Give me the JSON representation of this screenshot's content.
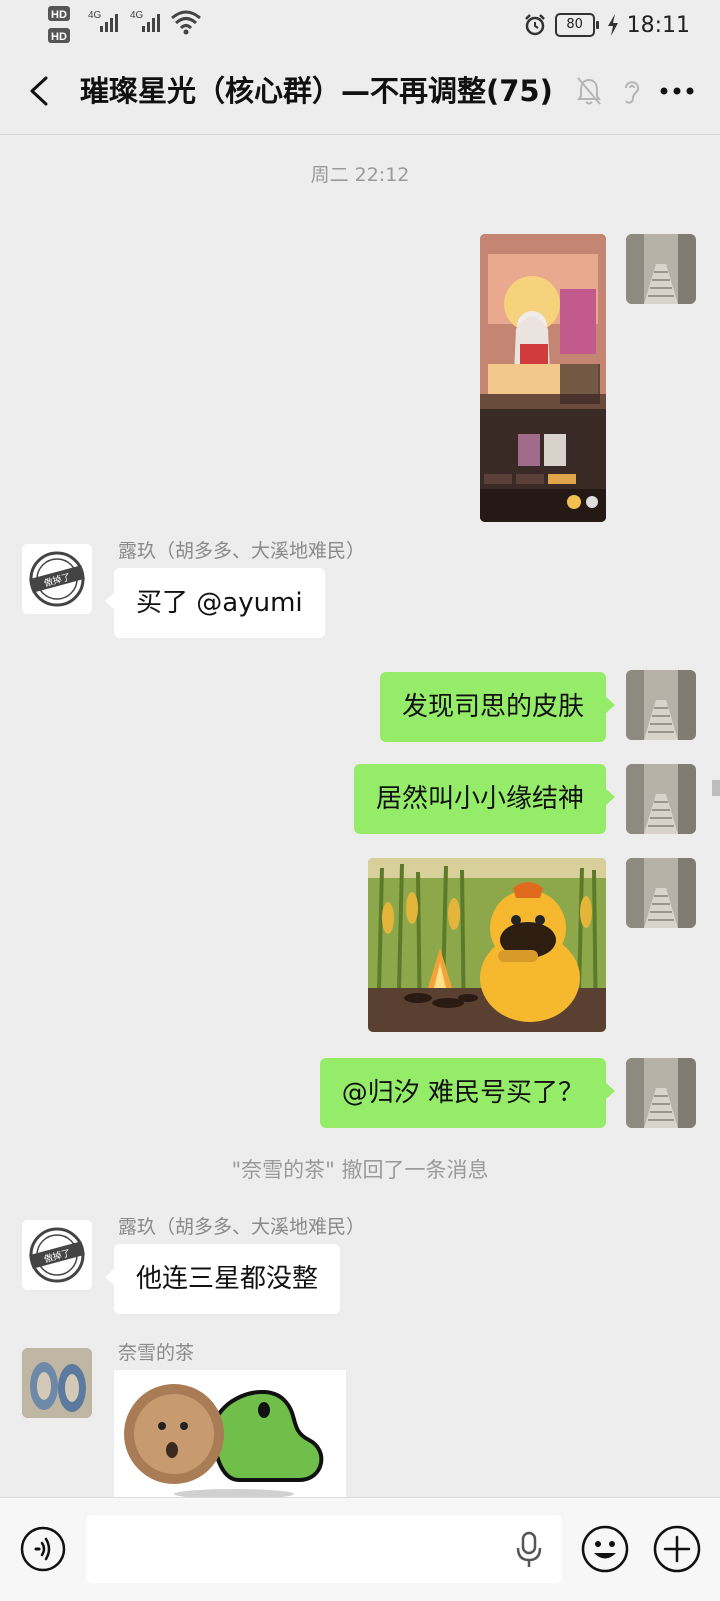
{
  "status_bar": {
    "time": "18:11",
    "battery": "80",
    "network_1": "4G",
    "network_2": "4G",
    "hd_1": "HD",
    "hd_2": "HD"
  },
  "header": {
    "title": "璀璨星光（核心群）—不再调整(75)"
  },
  "messages": {
    "timestamp": "周二 22:12",
    "m2": {
      "sender": "露玖（胡多多、大溪地难民）",
      "text": "买了 @ayumi"
    },
    "m3": {
      "text": "发现司思的皮肤"
    },
    "m4": {
      "text": "居然叫小小缘结神"
    },
    "m6": {
      "text": "@归汐  难民号买了？"
    },
    "recall_notice": "\"奈雪的茶\" 撤回了一条消息",
    "m7": {
      "sender": "露玖（胡多多、大溪地难民）",
      "text": "他连三星都没整"
    },
    "m8": {
      "sender": "奈雪的茶"
    }
  },
  "avatar_lujiu_stamp": "傲掉了",
  "input": {
    "placeholder": ""
  },
  "colors": {
    "background": "#ededed",
    "outgoing_bubble": "#95ec69",
    "incoming_bubble": "#ffffff"
  }
}
